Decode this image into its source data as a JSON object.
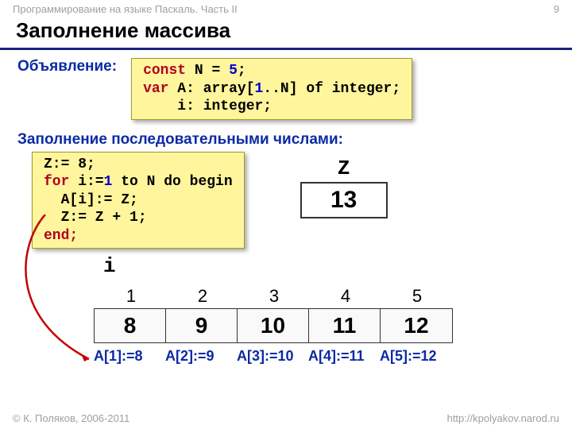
{
  "header": {
    "course": "Программирование на языке Паскаль. Часть II",
    "page": "9"
  },
  "title": "Заполнение массива",
  "decl": {
    "label": "Объявление:",
    "line1_kw": "const",
    "line1_rest": " N = ",
    "line1_n": "5",
    "line1_end": ";",
    "line2_kw": "var",
    "line2_rest": " A: array[",
    "line2_one": "1",
    "line2_rest2": "..N] of integer;",
    "line3": "    i: integer;"
  },
  "fill": {
    "label": "Заполнение последовательными числами:",
    "code_l1": "Z:= 8;",
    "code_l2a": "for",
    "code_l2b": " i:=",
    "code_l2one": "1",
    "code_l2c": " to N do begin",
    "code_l3": "  A[i]:= Z;",
    "code_l4": "  Z:= Z + 1;",
    "code_l5": "end;"
  },
  "z": {
    "label": "Z",
    "value": "13"
  },
  "iLabel": "i",
  "array": {
    "indices": [
      "1",
      "2",
      "3",
      "4",
      "5"
    ],
    "values": [
      "8",
      "9",
      "10",
      "11",
      "12"
    ],
    "assigns": [
      "A[1]:=8",
      "A[2]:=9",
      "A[3]:=10",
      "A[4]:=11",
      "A[5]:=12"
    ]
  },
  "footer": {
    "left": "© К. Поляков, 2006-2011",
    "right": "http://kpolyakov.narod.ru"
  }
}
